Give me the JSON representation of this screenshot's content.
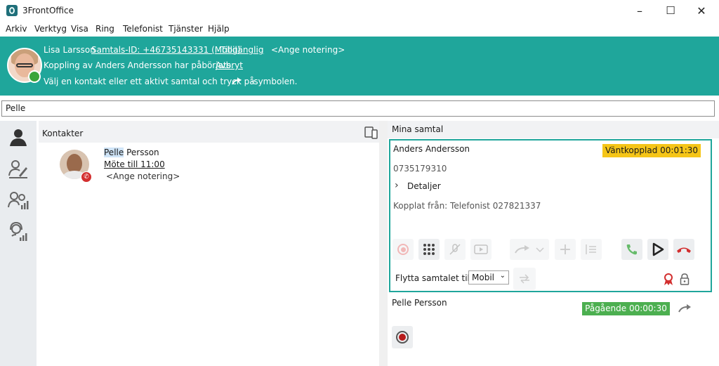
{
  "window": {
    "title": "3FrontOffice",
    "minimize": "–",
    "maximize": "☐",
    "close": "✕"
  },
  "menu": [
    "Arkiv",
    "Verktyg",
    "Visa",
    "Ring",
    "Telefonist",
    "Tjänster",
    "Hjälp"
  ],
  "banner": {
    "user_name": "Lisa Larsson",
    "call_id": "Samtals-ID: +46735143331 (Mobil)",
    "status": "Tillgänglig",
    "note": "<Ange notering>",
    "transfer_msg": "Koppling av Anders Andersson har påbörjats.",
    "abort": "Avbryt",
    "instruction_pre": "Välj en kontakt eller ett aktivt samtal och tryck på",
    "instruction_post": "-symbolen."
  },
  "search": {
    "value": "Pelle"
  },
  "contacts": {
    "title": "Kontakter",
    "items": [
      {
        "first": "Pelle",
        "last": " Persson",
        "meeting": "Möte till 11:00",
        "note": "<Ange notering>"
      }
    ]
  },
  "calls": {
    "title": "Mina samtal",
    "active": {
      "name": "Anders Andersson",
      "status": "Väntkopplad 00:01:30",
      "number": "0735179310",
      "details": "Detaljer",
      "connected_from": "Kopplat från: Telefonist 027821337",
      "move_label": "Flytta samtalet till:",
      "move_value": "Mobil"
    },
    "second": {
      "name": "Pelle Persson",
      "status": "Pågående 00:00:30"
    }
  },
  "colors": {
    "accent": "#1fa69b",
    "hold": "#f5c518",
    "ongoing": "#4caf50",
    "hangup": "#d32f2f"
  }
}
